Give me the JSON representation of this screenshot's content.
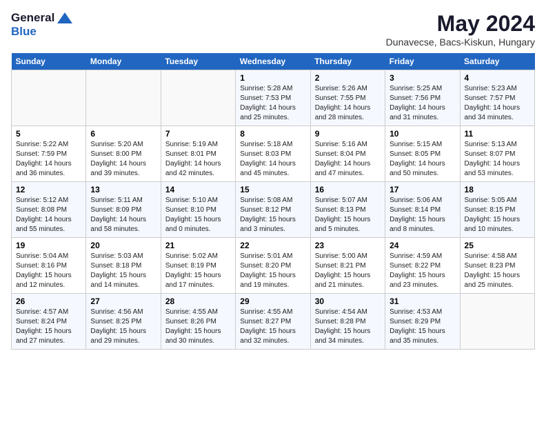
{
  "logo": {
    "general": "General",
    "blue": "Blue"
  },
  "title": "May 2024",
  "subtitle": "Dunavecse, Bacs-Kiskun, Hungary",
  "headers": [
    "Sunday",
    "Monday",
    "Tuesday",
    "Wednesday",
    "Thursday",
    "Friday",
    "Saturday"
  ],
  "weeks": [
    [
      {
        "day": "",
        "info": ""
      },
      {
        "day": "",
        "info": ""
      },
      {
        "day": "",
        "info": ""
      },
      {
        "day": "1",
        "info": "Sunrise: 5:28 AM\nSunset: 7:53 PM\nDaylight: 14 hours and 25 minutes."
      },
      {
        "day": "2",
        "info": "Sunrise: 5:26 AM\nSunset: 7:55 PM\nDaylight: 14 hours and 28 minutes."
      },
      {
        "day": "3",
        "info": "Sunrise: 5:25 AM\nSunset: 7:56 PM\nDaylight: 14 hours and 31 minutes."
      },
      {
        "day": "4",
        "info": "Sunrise: 5:23 AM\nSunset: 7:57 PM\nDaylight: 14 hours and 34 minutes."
      }
    ],
    [
      {
        "day": "5",
        "info": "Sunrise: 5:22 AM\nSunset: 7:59 PM\nDaylight: 14 hours and 36 minutes."
      },
      {
        "day": "6",
        "info": "Sunrise: 5:20 AM\nSunset: 8:00 PM\nDaylight: 14 hours and 39 minutes."
      },
      {
        "day": "7",
        "info": "Sunrise: 5:19 AM\nSunset: 8:01 PM\nDaylight: 14 hours and 42 minutes."
      },
      {
        "day": "8",
        "info": "Sunrise: 5:18 AM\nSunset: 8:03 PM\nDaylight: 14 hours and 45 minutes."
      },
      {
        "day": "9",
        "info": "Sunrise: 5:16 AM\nSunset: 8:04 PM\nDaylight: 14 hours and 47 minutes."
      },
      {
        "day": "10",
        "info": "Sunrise: 5:15 AM\nSunset: 8:05 PM\nDaylight: 14 hours and 50 minutes."
      },
      {
        "day": "11",
        "info": "Sunrise: 5:13 AM\nSunset: 8:07 PM\nDaylight: 14 hours and 53 minutes."
      }
    ],
    [
      {
        "day": "12",
        "info": "Sunrise: 5:12 AM\nSunset: 8:08 PM\nDaylight: 14 hours and 55 minutes."
      },
      {
        "day": "13",
        "info": "Sunrise: 5:11 AM\nSunset: 8:09 PM\nDaylight: 14 hours and 58 minutes."
      },
      {
        "day": "14",
        "info": "Sunrise: 5:10 AM\nSunset: 8:10 PM\nDaylight: 15 hours and 0 minutes."
      },
      {
        "day": "15",
        "info": "Sunrise: 5:08 AM\nSunset: 8:12 PM\nDaylight: 15 hours and 3 minutes."
      },
      {
        "day": "16",
        "info": "Sunrise: 5:07 AM\nSunset: 8:13 PM\nDaylight: 15 hours and 5 minutes."
      },
      {
        "day": "17",
        "info": "Sunrise: 5:06 AM\nSunset: 8:14 PM\nDaylight: 15 hours and 8 minutes."
      },
      {
        "day": "18",
        "info": "Sunrise: 5:05 AM\nSunset: 8:15 PM\nDaylight: 15 hours and 10 minutes."
      }
    ],
    [
      {
        "day": "19",
        "info": "Sunrise: 5:04 AM\nSunset: 8:16 PM\nDaylight: 15 hours and 12 minutes."
      },
      {
        "day": "20",
        "info": "Sunrise: 5:03 AM\nSunset: 8:18 PM\nDaylight: 15 hours and 14 minutes."
      },
      {
        "day": "21",
        "info": "Sunrise: 5:02 AM\nSunset: 8:19 PM\nDaylight: 15 hours and 17 minutes."
      },
      {
        "day": "22",
        "info": "Sunrise: 5:01 AM\nSunset: 8:20 PM\nDaylight: 15 hours and 19 minutes."
      },
      {
        "day": "23",
        "info": "Sunrise: 5:00 AM\nSunset: 8:21 PM\nDaylight: 15 hours and 21 minutes."
      },
      {
        "day": "24",
        "info": "Sunrise: 4:59 AM\nSunset: 8:22 PM\nDaylight: 15 hours and 23 minutes."
      },
      {
        "day": "25",
        "info": "Sunrise: 4:58 AM\nSunset: 8:23 PM\nDaylight: 15 hours and 25 minutes."
      }
    ],
    [
      {
        "day": "26",
        "info": "Sunrise: 4:57 AM\nSunset: 8:24 PM\nDaylight: 15 hours and 27 minutes."
      },
      {
        "day": "27",
        "info": "Sunrise: 4:56 AM\nSunset: 8:25 PM\nDaylight: 15 hours and 29 minutes."
      },
      {
        "day": "28",
        "info": "Sunrise: 4:55 AM\nSunset: 8:26 PM\nDaylight: 15 hours and 30 minutes."
      },
      {
        "day": "29",
        "info": "Sunrise: 4:55 AM\nSunset: 8:27 PM\nDaylight: 15 hours and 32 minutes."
      },
      {
        "day": "30",
        "info": "Sunrise: 4:54 AM\nSunset: 8:28 PM\nDaylight: 15 hours and 34 minutes."
      },
      {
        "day": "31",
        "info": "Sunrise: 4:53 AM\nSunset: 8:29 PM\nDaylight: 15 hours and 35 minutes."
      },
      {
        "day": "",
        "info": ""
      }
    ]
  ]
}
